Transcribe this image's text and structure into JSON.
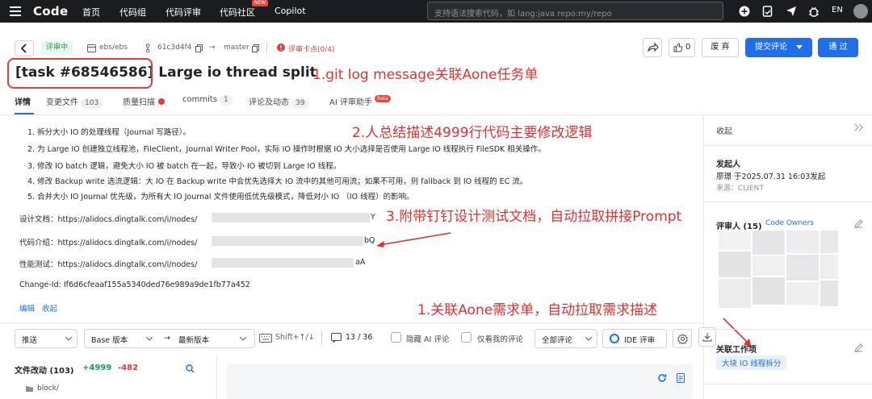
{
  "nav": {
    "logo": "Code",
    "items": [
      "首页",
      "代码组",
      "代码评审",
      "代码社区",
      "Copilot"
    ],
    "new_badge": "NEW",
    "search_placeholder": "支持语法搜索代码，如 lang:java repo:my/repo",
    "lang": "EN"
  },
  "header": {
    "status_tag": "评审中",
    "repo": "ebs/ebs",
    "commit": "61c3d4f4",
    "arrow": "→",
    "target_branch": "master",
    "checkpoint": "评审卡点(0/4)",
    "title": "[task #68546586] Large io thread split",
    "like_count": "0",
    "abandon_label": "废 弃",
    "submit_review_label": "提交评论",
    "approve_label": "通 过"
  },
  "annotations": {
    "a1": "1.git log message关联Aone任务单",
    "a2": "2.人总结描述4999行代码主要修改逻辑",
    "a3": "3.附带钉钉设计测试文档，自动拉取拼接Prompt",
    "a4": "1.关联Aone需求单，自动拉取需求描述"
  },
  "tabs": [
    {
      "label": "详情",
      "count": ""
    },
    {
      "label": "变更文件",
      "count": "103"
    },
    {
      "label": "质量扫描",
      "count": ""
    },
    {
      "label": "commits",
      "count": "1"
    },
    {
      "label": "评论及动态",
      "count": "39"
    },
    {
      "label": "AI 评审助手",
      "count": "Beta"
    }
  ],
  "description": {
    "items": [
      "1. 拆分大小 IO 的处理线程（Journal 写路径）。",
      "2. 为 Large IO 创建独立线程池，FileClient，Journal Writer Pool，实际 IO 操作时根据 IO 大小选择是否使用 Large IO 线程执行 FileSDK 相关操作。",
      "3. 修改 IO batch 逻辑，避免大小 IO 被 batch 在一起，导致小 IO 被切到 Large IO 线程。",
      "4. 修改 Backup write 选流逻辑：大 IO 在 Backup write 中会优先选择大 IO 流中的其他可用流；如果不可用，则 fallback 到 IO 线程的 EC 流。",
      "5. 合并大小 IO Journal 优先级，为所有大 IO Journal 文件使用低优先级模式，降低对小 IO （IO 线程）的影响。"
    ],
    "design_doc": "设计文档：https://alidocs.dingtalk.com/i/nodes/",
    "design_doc_tail": "Y",
    "code_doc": "代码介绍：https://alidocs.dingtalk.com/i/nodes/",
    "code_doc_tail": "bQ",
    "perf_doc": "性能测试：https://alidocs.dingtalk.com/i/nodes/",
    "perf_doc_tail": "aA",
    "change_id": "Change-Id: If6d6cfeaaf155a5340ded76e989a9de1fb77a452",
    "edit_label": "编辑",
    "collapse_label": "收起"
  },
  "toolbar": {
    "push": "推送",
    "base": "Base 版本",
    "latest": "最新版本",
    "shortcut": "Shift+↑/↓",
    "progress": "13 / 36",
    "hide_ai": "隐藏 AI 评论",
    "only_mine": "仅看我的评论",
    "all_comments": "全部评论",
    "ide_review": "IDE 评审"
  },
  "files": {
    "header": "文件改动 (103)",
    "added": "+4999",
    "removed": "-482",
    "first_dir": "block/"
  },
  "right_panel": {
    "collapse": "收起",
    "initiator_label": "发起人",
    "initiator": "廖璟 于2025.07.31 16:03发起",
    "source": "来源：CLIENT",
    "reviewers_label": "评审人 (15)",
    "code_owners": "Code Owners",
    "work_items_label": "关联工作项",
    "work_item": "大块 IO 线程拆分"
  },
  "colors": {
    "nav_bg": "#1b1c1f",
    "accent": "#1f6feb",
    "annotation_red": "#e52f2f",
    "add_green": "#1d9c4e",
    "remove_red": "#e23c3c"
  }
}
